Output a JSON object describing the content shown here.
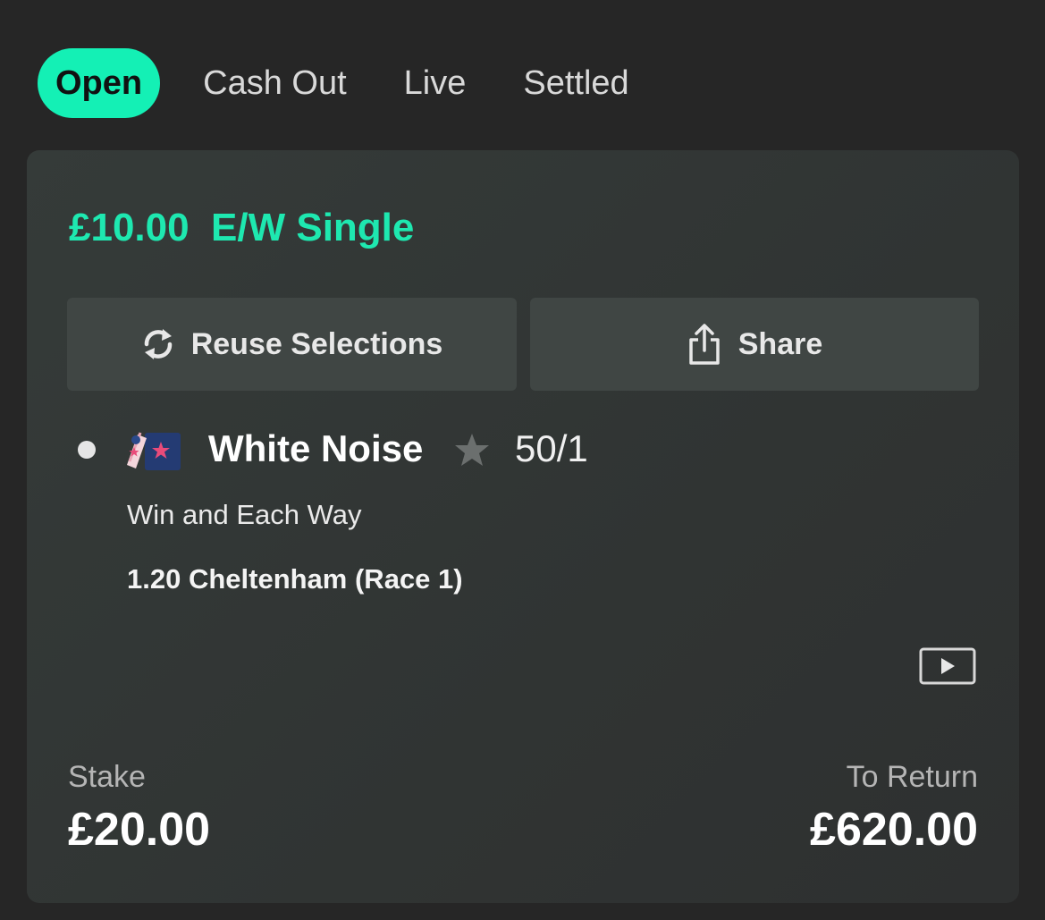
{
  "tabs": [
    {
      "label": "Open",
      "active": true
    },
    {
      "label": "Cash Out",
      "active": false
    },
    {
      "label": "Live",
      "active": false
    },
    {
      "label": "Settled",
      "active": false
    }
  ],
  "bet": {
    "title": "£10.00  E/W Single",
    "reuse_label": "Reuse Selections",
    "reuse_icon": "refresh-icon",
    "share_label": "Share",
    "share_icon": "share-icon",
    "selection": {
      "horse": "White Noise",
      "odds": "50/1",
      "market": "Win and Each Way",
      "race": "1.20 Cheltenham (Race 1)",
      "silks_icon": "jockey-silks-icon",
      "star_icon": "star-icon",
      "video_icon": "play-video-icon"
    },
    "stake_label": "Stake",
    "stake_value": "£20.00",
    "return_label": "To Return",
    "return_value": "£620.00"
  },
  "colors": {
    "accent": "#14f0b5",
    "title_green": "#1ee8b0",
    "background": "#262626",
    "card": "#333837"
  }
}
